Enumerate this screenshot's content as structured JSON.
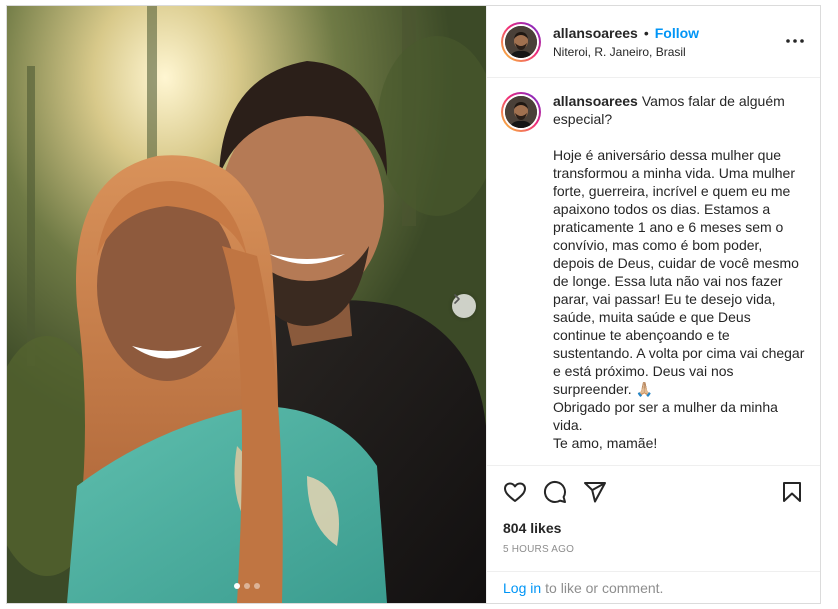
{
  "post": {
    "username": "allansoarees",
    "separator": "•",
    "follow_label": "Follow",
    "location": "Niteroi, R. Janeiro, Brasil",
    "caption": "Vamos falar de alguém especial?\n\nHoje é aniversário dessa mulher que transformou a minha vida. Uma mulher forte, guerreira, incrível e quem eu me apaixono todos os dias. Estamos a praticamente 1 ano e 6 meses sem o convívio, mas como é bom poder, depois de Deus, cuidar de você mesmo de longe. Essa luta não vai nos fazer parar, vai passar! Eu te desejo vida, saúde, muita saúde e que Deus continue te abençoando e te sustentando. A volta por cima vai chegar e está próximo. Deus vai nos surpreender. 🙏🏼\nObrigado por ser a mulher da minha vida.\nTe amo, mamãe!",
    "likes": "804 likes",
    "timestamp": "5 HOURS AGO",
    "carousel": {
      "total": 3,
      "current": 1
    }
  },
  "login_prompt": {
    "link": "Log in",
    "text": "to like or comment."
  },
  "icons": {
    "more": "more-options-icon",
    "like": "heart-icon",
    "comment": "comment-icon",
    "share": "paper-plane-icon",
    "save": "bookmark-icon",
    "next": "chevron-right-icon"
  },
  "colors": {
    "link_blue": "#0095f6",
    "text": "#262626",
    "muted": "#8e8e8e",
    "border": "#dbdbdb"
  }
}
